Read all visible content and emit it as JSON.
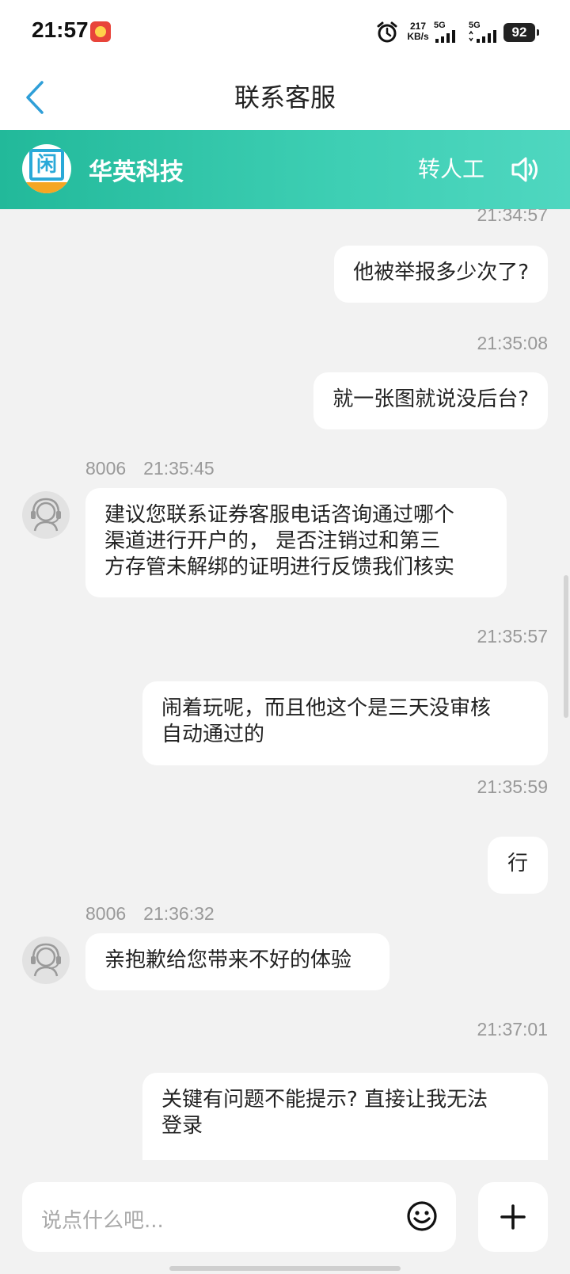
{
  "status_bar": {
    "time": "21:57",
    "net_speed_value": "217",
    "net_speed_unit": "KB/s",
    "signal_1_label": "5G",
    "signal_2_label": "5G",
    "battery": "92"
  },
  "nav": {
    "title": "联系客服"
  },
  "agent_header": {
    "logo_text": "闲",
    "name": "华英科技",
    "transfer_label": "转人工"
  },
  "messages": [
    {
      "side": "right",
      "time": "21:34:57",
      "text": "他被举报多少次了?"
    },
    {
      "side": "right",
      "time": "21:35:08",
      "text": "就一张图就说没后台?"
    },
    {
      "side": "left",
      "sender": "8006",
      "time": "21:35:45",
      "lines": [
        "建议您联系证券客服电话咨询通过哪个",
        "渠道进行开户的， 是否注销过和第三",
        "方存管未解绑的证明进行反馈我们核实"
      ]
    },
    {
      "side": "right",
      "time": "21:35:57",
      "lines": [
        "闹着玩呢，而且他这个是三天没审核",
        "自动通过的"
      ]
    },
    {
      "side": "right",
      "time": "21:35:59",
      "text": "行"
    },
    {
      "side": "left",
      "sender": "8006",
      "time": "21:36:32",
      "text": "亲抱歉给您带来不好的体验"
    },
    {
      "side": "right",
      "time": "21:37:01",
      "lines": [
        "关键有问题不能提示? 直接让我无法",
        "登录"
      ]
    }
  ],
  "input": {
    "placeholder": "说点什么吧..."
  },
  "colors": {
    "header_start": "#22b99a",
    "header_end": "#4fd7c0",
    "back_arrow": "#2f9fd8",
    "chat_background": "#f2f2f2"
  }
}
